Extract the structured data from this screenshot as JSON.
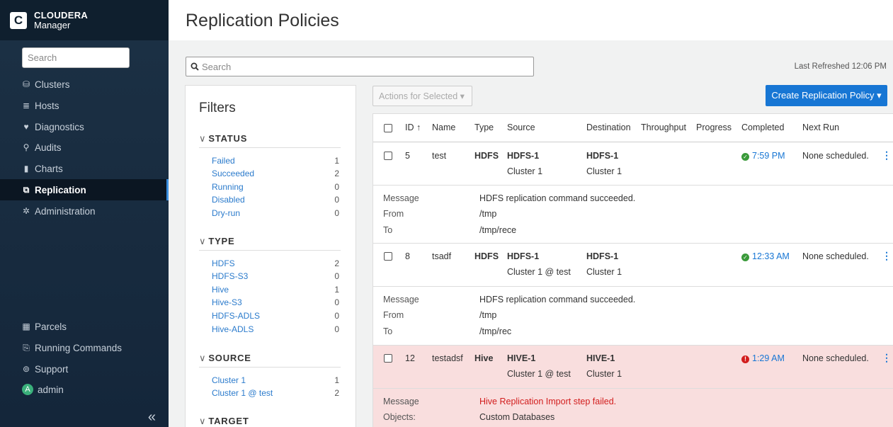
{
  "brand": {
    "name": "CLOUDERA",
    "sub": "Manager",
    "logo": "C"
  },
  "sidebar": {
    "search_placeholder": "Search",
    "items": [
      {
        "label": "Clusters",
        "icon": "clusters-icon",
        "glyph": "⛁"
      },
      {
        "label": "Hosts",
        "icon": "hosts-icon",
        "glyph": "≣"
      },
      {
        "label": "Diagnostics",
        "icon": "diagnostics-icon",
        "glyph": "♥"
      },
      {
        "label": "Audits",
        "icon": "binoculars-icon",
        "glyph": "⚲"
      },
      {
        "label": "Charts",
        "icon": "charts-icon",
        "glyph": "▮"
      },
      {
        "label": "Replication",
        "icon": "replication-icon",
        "glyph": "⧉"
      },
      {
        "label": "Administration",
        "icon": "gear-icon",
        "glyph": "✲"
      }
    ],
    "bottom_items": [
      {
        "label": "Parcels",
        "icon": "gift-icon",
        "glyph": "▦"
      },
      {
        "label": "Running Commands",
        "icon": "commands-icon",
        "glyph": "⎘"
      },
      {
        "label": "Support",
        "icon": "support-icon",
        "glyph": "⊚"
      },
      {
        "label": "admin",
        "avatar": "A"
      }
    ],
    "collapse_glyph": "«"
  },
  "page": {
    "title": "Replication Policies",
    "search_placeholder": "Search",
    "last_refreshed": "Last Refreshed 12:06 PM"
  },
  "filters": {
    "title": "Filters",
    "status": {
      "label": "STATUS",
      "items": [
        {
          "label": "Failed",
          "count": "1"
        },
        {
          "label": "Succeeded",
          "count": "2"
        },
        {
          "label": "Running",
          "count": "0"
        },
        {
          "label": "Disabled",
          "count": "0"
        },
        {
          "label": "Dry-run",
          "count": "0"
        }
      ]
    },
    "type": {
      "label": "TYPE",
      "items": [
        {
          "label": "HDFS",
          "count": "2"
        },
        {
          "label": "HDFS-S3",
          "count": "0"
        },
        {
          "label": "Hive",
          "count": "1"
        },
        {
          "label": "Hive-S3",
          "count": "0"
        },
        {
          "label": "HDFS-ADLS",
          "count": "0"
        },
        {
          "label": "Hive-ADLS",
          "count": "0"
        }
      ]
    },
    "source": {
      "label": "SOURCE",
      "items": [
        {
          "label": "Cluster 1",
          "count": "1"
        },
        {
          "label": "Cluster 1 @ test",
          "count": "2"
        }
      ]
    },
    "target": {
      "label": "TARGET"
    }
  },
  "toolbar": {
    "actions_label": "Actions for Selected ▾",
    "create_label": "Create Replication Policy ▾"
  },
  "table": {
    "headers": {
      "id": "ID",
      "sort": "↑",
      "name": "Name",
      "type": "Type",
      "source": "Source",
      "destination": "Destination",
      "throughput": "Throughput",
      "progress": "Progress",
      "completed": "Completed",
      "next_run": "Next Run"
    },
    "rows": [
      {
        "id": "5",
        "name": "test",
        "type": "HDFS",
        "source": "HDFS-1",
        "source_cluster": "Cluster 1",
        "dest": "HDFS-1",
        "dest_cluster": "Cluster 1",
        "completed": "7:59 PM",
        "status": "success",
        "next_run": "None scheduled.",
        "details": [
          {
            "k": "Message",
            "v": "HDFS replication command succeeded."
          },
          {
            "k": "From",
            "v": "/tmp"
          },
          {
            "k": "To",
            "v": "/tmp/rece"
          }
        ]
      },
      {
        "id": "8",
        "name": "tsadf",
        "type": "HDFS",
        "source": "HDFS-1",
        "source_cluster": "Cluster 1 @ test",
        "dest": "HDFS-1",
        "dest_cluster": "Cluster 1",
        "completed": "12:33 AM",
        "status": "success",
        "next_run": "None scheduled.",
        "details": [
          {
            "k": "Message",
            "v": "HDFS replication command succeeded."
          },
          {
            "k": "From",
            "v": "/tmp"
          },
          {
            "k": "To",
            "v": "/tmp/rec"
          }
        ]
      },
      {
        "id": "12",
        "name": "testadsf",
        "type": "Hive",
        "source": "HIVE-1",
        "source_cluster": "Cluster 1 @ test",
        "dest": "HIVE-1",
        "dest_cluster": "Cluster 1",
        "completed": "1:29 AM",
        "status": "failed",
        "next_run": "None scheduled.",
        "details": [
          {
            "k": "Message",
            "v": "Hive Replication Import step failed."
          },
          {
            "k": "Objects:",
            "v": "Custom Databases"
          }
        ]
      }
    ]
  },
  "colors": {
    "sidebar_bg": "#1c3145",
    "accent": "#1776d4",
    "link": "#2b7bcc",
    "error_bg": "#f9dede",
    "error_text": "#d21d1d",
    "success": "#3a9a3a"
  }
}
